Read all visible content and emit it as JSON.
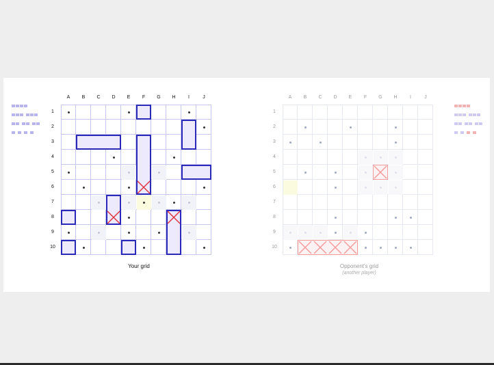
{
  "columns": [
    "A",
    "B",
    "C",
    "D",
    "E",
    "F",
    "G",
    "H",
    "I",
    "J"
  ],
  "rows": [
    "1",
    "2",
    "3",
    "4",
    "5",
    "6",
    "7",
    "8",
    "9",
    "10"
  ],
  "colors": {
    "player_ship_border": "#2a28b8",
    "player_ship_fill": "#eceafc",
    "player_hit": "#e0303f",
    "opponent_hit": "#f59a9a",
    "miss_dot_player": "#333333",
    "miss_dot_opponent": "#a0a8c0",
    "highlight": "#fbfbe0"
  },
  "player": {
    "caption": "Your grid",
    "ships": [
      {
        "col": "F",
        "row": "1",
        "length": 1,
        "orientation": "h"
      },
      {
        "col": "I",
        "row": "2",
        "length": 2,
        "orientation": "v"
      },
      {
        "col": "B",
        "row": "3",
        "length": 3,
        "orientation": "h"
      },
      {
        "col": "F",
        "row": "3",
        "length": 4,
        "orientation": "v"
      },
      {
        "col": "I",
        "row": "5",
        "length": 2,
        "orientation": "h"
      },
      {
        "col": "D",
        "row": "7",
        "length": 2,
        "orientation": "v"
      },
      {
        "col": "A",
        "row": "8",
        "length": 1,
        "orientation": "h"
      },
      {
        "col": "H",
        "row": "8",
        "length": 3,
        "orientation": "v"
      },
      {
        "col": "A",
        "row": "10",
        "length": 1,
        "orientation": "h"
      },
      {
        "col": "E",
        "row": "10",
        "length": 1,
        "orientation": "h"
      }
    ],
    "hits": [
      {
        "col": "F",
        "row": "6"
      },
      {
        "col": "D",
        "row": "8"
      },
      {
        "col": "H",
        "row": "8"
      }
    ],
    "misses": [
      {
        "col": "A",
        "row": "1"
      },
      {
        "col": "E",
        "row": "1"
      },
      {
        "col": "I",
        "row": "1"
      },
      {
        "col": "J",
        "row": "2"
      },
      {
        "col": "D",
        "row": "4"
      },
      {
        "col": "H",
        "row": "4"
      },
      {
        "col": "A",
        "row": "5"
      },
      {
        "col": "B",
        "row": "6"
      },
      {
        "col": "E",
        "row": "6"
      },
      {
        "col": "J",
        "row": "6"
      },
      {
        "col": "F",
        "row": "7"
      },
      {
        "col": "H",
        "row": "7"
      },
      {
        "col": "E",
        "row": "8"
      },
      {
        "col": "A",
        "row": "9"
      },
      {
        "col": "E",
        "row": "9"
      },
      {
        "col": "G",
        "row": "9"
      },
      {
        "col": "B",
        "row": "10"
      },
      {
        "col": "F",
        "row": "10"
      },
      {
        "col": "J",
        "row": "10"
      }
    ],
    "near_misses": [
      {
        "col": "E",
        "row": "5"
      },
      {
        "col": "G",
        "row": "5"
      },
      {
        "col": "C",
        "row": "7"
      },
      {
        "col": "E",
        "row": "7"
      },
      {
        "col": "G",
        "row": "7"
      },
      {
        "col": "I",
        "row": "7"
      },
      {
        "col": "C",
        "row": "9"
      },
      {
        "col": "I",
        "row": "9"
      }
    ],
    "highlight": [
      {
        "col": "F",
        "row": "7"
      }
    ]
  },
  "opponent": {
    "caption": "Opponent's grid",
    "subcaption": "(another player)",
    "sunk_ships": [
      {
        "col": "G",
        "row": "5",
        "length": 1,
        "orientation": "h"
      },
      {
        "col": "B",
        "row": "10",
        "length": 4,
        "orientation": "h"
      }
    ],
    "misses": [
      {
        "col": "B",
        "row": "2"
      },
      {
        "col": "E",
        "row": "2"
      },
      {
        "col": "H",
        "row": "2"
      },
      {
        "col": "A",
        "row": "3"
      },
      {
        "col": "C",
        "row": "3"
      },
      {
        "col": "H",
        "row": "3"
      },
      {
        "col": "B",
        "row": "5"
      },
      {
        "col": "D",
        "row": "5"
      },
      {
        "col": "D",
        "row": "6"
      },
      {
        "col": "D",
        "row": "8"
      },
      {
        "col": "H",
        "row": "8"
      },
      {
        "col": "I",
        "row": "8"
      },
      {
        "col": "D",
        "row": "9"
      },
      {
        "col": "F",
        "row": "9"
      },
      {
        "col": "A",
        "row": "10"
      },
      {
        "col": "F",
        "row": "10"
      },
      {
        "col": "G",
        "row": "10"
      },
      {
        "col": "H",
        "row": "10"
      },
      {
        "col": "I",
        "row": "10"
      }
    ],
    "near_misses": [
      {
        "col": "G",
        "row": "4"
      },
      {
        "col": "F",
        "row": "4"
      },
      {
        "col": "H",
        "row": "4"
      },
      {
        "col": "F",
        "row": "5"
      },
      {
        "col": "H",
        "row": "5"
      },
      {
        "col": "A",
        "row": "6"
      },
      {
        "col": "F",
        "row": "6"
      },
      {
        "col": "G",
        "row": "6"
      },
      {
        "col": "H",
        "row": "6"
      },
      {
        "col": "A",
        "row": "9"
      },
      {
        "col": "B",
        "row": "9"
      },
      {
        "col": "C",
        "row": "9"
      },
      {
        "col": "E",
        "row": "9"
      }
    ],
    "highlight": [
      {
        "col": "A",
        "row": "6"
      }
    ]
  },
  "fleet_left": {
    "color": "#b8b4ee",
    "rows": [
      [
        4
      ],
      [
        3,
        3
      ],
      [
        2,
        2,
        2
      ],
      [
        1,
        1,
        1,
        1
      ]
    ]
  },
  "fleet_right": {
    "rows": [
      {
        "segments": [
          4
        ],
        "colors": [
          "#f2b3b3"
        ]
      },
      {
        "segments": [
          3,
          3
        ],
        "colors": [
          "#cfcaf3",
          "#cfcaf3"
        ]
      },
      {
        "segments": [
          2,
          2,
          2
        ],
        "colors": [
          "#cfcaf3",
          "#cfcaf3",
          "#cfcaf3"
        ]
      },
      {
        "segments": [
          1,
          1,
          1,
          1
        ],
        "colors": [
          "#cfcaf3",
          "#cfcaf3",
          "#f2b3b3",
          "#f2b3b3"
        ]
      }
    ]
  }
}
